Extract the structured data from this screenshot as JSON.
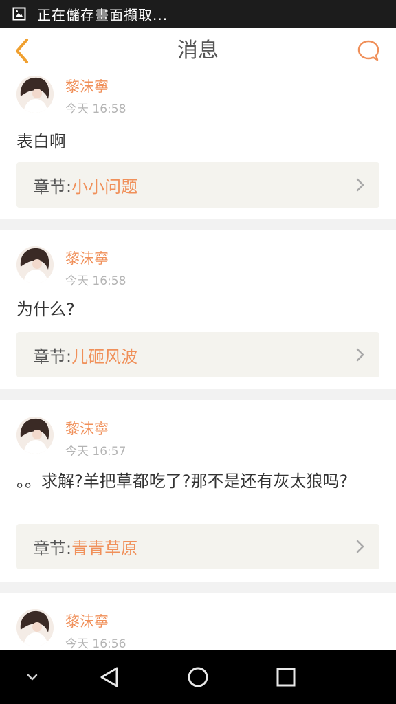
{
  "status_bar": {
    "text": "正在儲存畫面擷取..."
  },
  "header": {
    "title": "消息"
  },
  "colors": {
    "accent": "#f0905a",
    "status_bar_bg": "#1c1c1c",
    "chapter_bg": "#f4f3ee",
    "divider": "#f2f2f2"
  },
  "messages": [
    {
      "user": "黎沫寧",
      "time": "今天 16:58",
      "text": "表白啊",
      "chapter_label": "章节:",
      "chapter_name": "小小问题"
    },
    {
      "user": "黎沫寧",
      "time": "今天 16:58",
      "text": "为什么?",
      "chapter_label": "章节:",
      "chapter_name": "儿砸风波"
    },
    {
      "user": "黎沫寧",
      "time": "今天 16:57",
      "text": "。。求解?羊把草都吃了?那不是还有灰太狼吗?",
      "chapter_label": "章节:",
      "chapter_name": "青青草原"
    },
    {
      "user": "黎沫寧",
      "time": "今天 16:56"
    }
  ],
  "icons": {
    "back": "chevron-left-icon",
    "comment": "speech-bubble-icon",
    "nav_down": "chevron-down-icon",
    "nav_back": "triangle-back-icon",
    "nav_home": "circle-home-icon",
    "nav_recent": "square-recents-icon"
  }
}
